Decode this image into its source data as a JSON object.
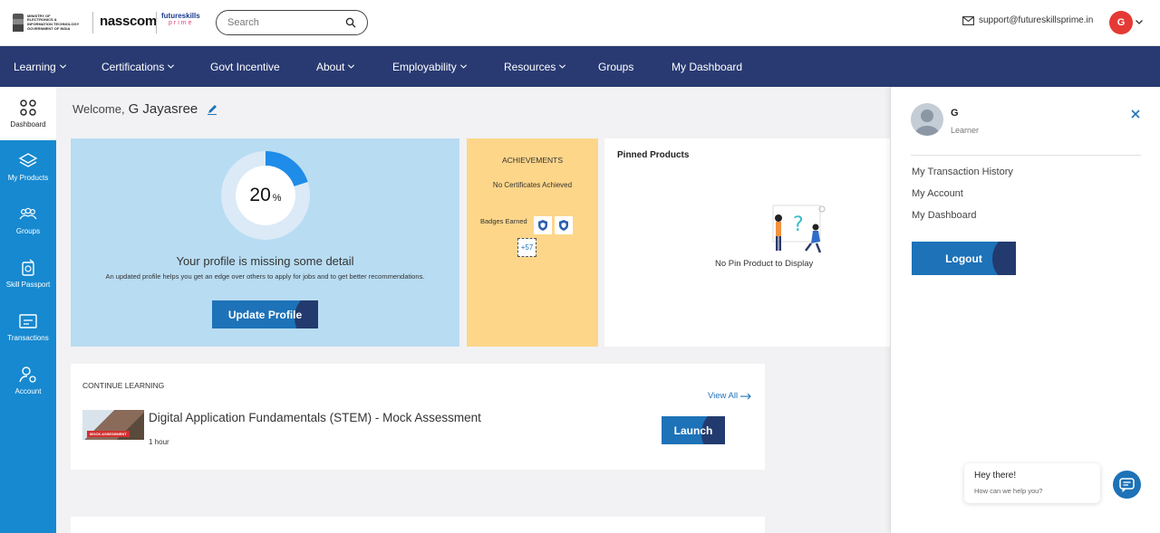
{
  "header": {
    "govt_logo_text": [
      "MINISTRY OF",
      "ELECTRONICS &",
      "INFORMATION TECHNOLOGY",
      "GOVERNMENT OF INDIA"
    ],
    "nasscom_logo": "nasscom",
    "futureskills_logo": [
      "futureskills",
      "prime"
    ],
    "search_placeholder": "Search",
    "support_email": "support@futureskillsprime.in",
    "avatar_initial": "G"
  },
  "nav": {
    "items": [
      {
        "label": "Learning",
        "dropdown": true
      },
      {
        "label": "Certifications",
        "dropdown": true
      },
      {
        "label": "Govt Incentive",
        "dropdown": false
      },
      {
        "label": "About",
        "dropdown": true
      },
      {
        "label": "Employability",
        "dropdown": true
      },
      {
        "label": "Resources",
        "dropdown": true
      },
      {
        "label": "Groups",
        "dropdown": false
      },
      {
        "label": "My Dashboard",
        "dropdown": false
      }
    ]
  },
  "sidebar": {
    "items": [
      {
        "label": "Dashboard",
        "icon": "dashboard-icon",
        "active": true
      },
      {
        "label": "My Products",
        "icon": "layers-icon",
        "active": false
      },
      {
        "label": "Groups",
        "icon": "groups-icon",
        "active": false
      },
      {
        "label": "Skill Passport",
        "icon": "passport-icon",
        "active": false
      },
      {
        "label": "Transactions",
        "icon": "transactions-icon",
        "active": false
      },
      {
        "label": "Account",
        "icon": "account-icon",
        "active": false
      }
    ]
  },
  "welcome": {
    "greeting": "Welcome,",
    "name": "G Jayasree"
  },
  "profile": {
    "completion_percent": 20,
    "completion_value": "20",
    "percent_sign": "%",
    "title": "Your profile is missing some detail",
    "subtitle": "An updated profile helps you get an edge over others to apply for jobs and to get better recommendations.",
    "button_label": "Update Profile"
  },
  "achievements": {
    "title": "ACHIEVEMENTS",
    "certificates_text": "No Certificates Achieved",
    "badges_label": "Badges Earned",
    "more_badges": "+57"
  },
  "pinned": {
    "title": "Pinned Products",
    "empty_text": "No Pin Product to Display"
  },
  "continue_learning": {
    "title": "CONTINUE LEARNING",
    "view_all": "View All",
    "course": {
      "thumb_tag": "MOCK ASSESSMENT",
      "title": "Digital Application Fundamentals (STEM) - Mock Assessment",
      "duration": "1 hour",
      "button_label": "Launch"
    }
  },
  "panel": {
    "name": "G",
    "role": "Learner",
    "links": [
      "My Transaction History",
      "My Account",
      "My Dashboard"
    ],
    "logout_label": "Logout"
  },
  "chat": {
    "greeting": "Hey there!",
    "prompt": "How can we help you?"
  },
  "colors": {
    "nav_bg": "#293a72",
    "sidebar_bg": "#1689d0",
    "profile_card_bg": "#b8dcf2",
    "achievements_bg": "#fdd68a",
    "button_blue": "#1d72b8",
    "avatar_red": "#e53935"
  }
}
